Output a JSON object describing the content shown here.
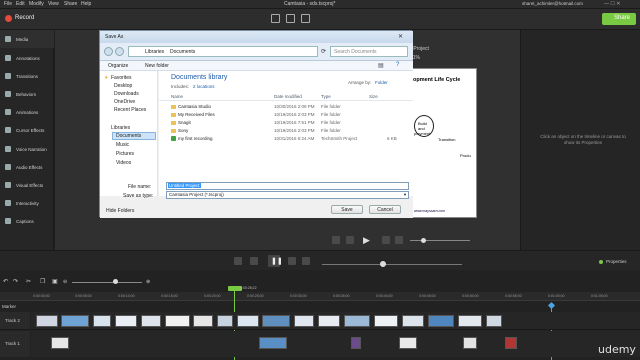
{
  "menubar": {
    "items": [
      "File",
      "Edit",
      "Modify",
      "View",
      "Share",
      "Help"
    ],
    "title": "Camtasia - sds.tscproj*",
    "user": "sharet_achimler@hotmail.com"
  },
  "toolbar": {
    "record_label": "Record",
    "share_label": "Share"
  },
  "sidebar": {
    "items": [
      "Media",
      "Annotations",
      "Transitions",
      "Behaviors",
      "Animations",
      "Cursor Effects",
      "Voice Narration",
      "Audio Effects",
      "Visual Effects",
      "Interactivity",
      "Captions"
    ]
  },
  "canvas": {
    "project_title": "Untitled Project",
    "zoom": "41%",
    "slide_title": "opment Life Cycle",
    "slide_labels": [
      "Build",
      "and",
      "ployment",
      "Transition",
      "Produ"
    ],
    "watermark": "www.mayssarn.com"
  },
  "props": {
    "hint": "Click an object on the timeline or canvas to show its Properties"
  },
  "dialog": {
    "title": "Save As",
    "breadcrumb": [
      "Libraries",
      "Documents"
    ],
    "search_placeholder": "Search Documents",
    "organize_label": "Organize",
    "newfolder_label": "New folder",
    "nav_favorites": "Favorites",
    "nav_fav_items": [
      "Desktop",
      "Downloads",
      "OneDrive",
      "Recent Places"
    ],
    "nav_libraries": "Libraries",
    "nav_lib_items": [
      "Documents",
      "Music",
      "Pictures",
      "Videos"
    ],
    "library_title": "Documents library",
    "includes_label": "Includes:",
    "includes_locations": "2 locations",
    "arrange_label": "Arrange by:",
    "arrange_value": "Folder",
    "columns": [
      "Name",
      "Date modified",
      "Type",
      "Size"
    ],
    "rows": [
      {
        "name": "Camtasia Studio",
        "date": "10/30/2016 2:09 PM",
        "type": "File folder",
        "size": ""
      },
      {
        "name": "My Received Files",
        "date": "10/19/2016 2:03 PM",
        "type": "File folder",
        "size": ""
      },
      {
        "name": "Snagit",
        "date": "10/19/2016 7:51 PM",
        "type": "File folder",
        "size": ""
      },
      {
        "name": "Sony",
        "date": "10/19/2016 2:03 PM",
        "type": "File folder",
        "size": ""
      },
      {
        "name": "my first recording",
        "date": "10/31/2016 6:24 AM",
        "type": "TechSmith Project",
        "size": "6 KB"
      }
    ],
    "filename_label": "File name:",
    "filename_value": "Untitled Project",
    "saveas_label": "Save as type:",
    "saveas_value": "Camtasia Project (*.tscproj)",
    "hide_folders": "Hide Folders",
    "save_label": "Save",
    "cancel_label": "Cancel"
  },
  "player": {
    "properties_label": "Properties"
  },
  "timeline": {
    "playhead_time": "0:00:28;22",
    "ruler": [
      "0:00:00;00",
      "0:00:05;00",
      "0:00:10;00",
      "0:00:15;00",
      "0:00:20;00",
      "0:00:25;00",
      "0:00:30;00",
      "0:00:35;00",
      "0:00:40;00",
      "0:00:45;00",
      "0:00:50;00",
      "0:00:55;00",
      "0:01:00;00",
      "0:01:05;00"
    ],
    "marker_label": "Marker",
    "tracks": [
      "Track 2",
      "Track 1"
    ]
  },
  "watermark": "udemy",
  "colors": {
    "accent": "#7ac943",
    "dialog_link": "#1e5aa8"
  }
}
